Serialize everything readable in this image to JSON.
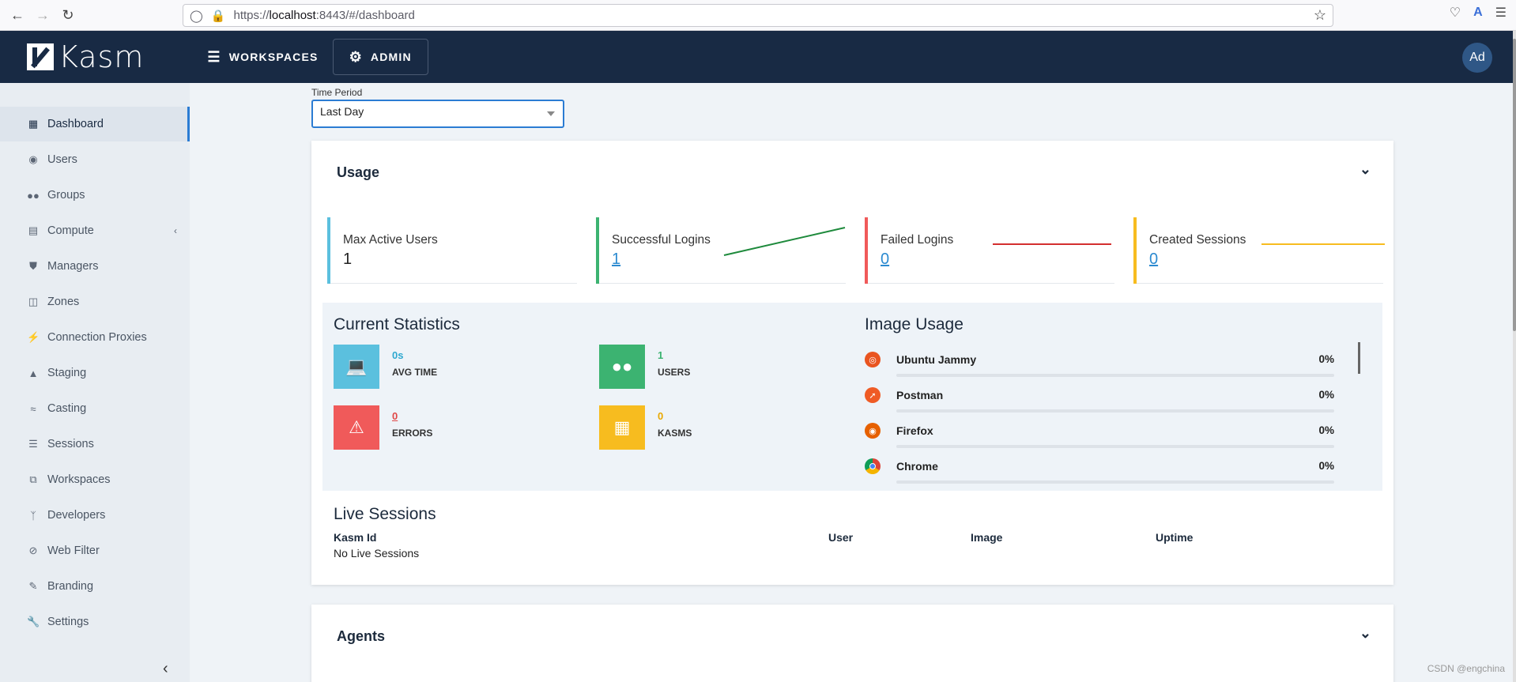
{
  "browser": {
    "url_prefix": "https://",
    "url_host": "localhost",
    "url_rest": ":8443/#/dashboard"
  },
  "app": {
    "logo_text": "Kasm",
    "tabs": [
      {
        "label": "WORKSPACES",
        "icon": "layers-icon"
      },
      {
        "label": "ADMIN",
        "icon": "gear-icon"
      }
    ],
    "avatar": "Ad"
  },
  "sidebar": {
    "items": [
      {
        "label": "Dashboard",
        "icon": "dashboard-icon",
        "active": true
      },
      {
        "label": "Users",
        "icon": "user-circle-icon"
      },
      {
        "label": "Groups",
        "icon": "users-icon"
      },
      {
        "label": "Compute",
        "icon": "server-icon",
        "expandable": true
      },
      {
        "label": "Managers",
        "icon": "shield-icon"
      },
      {
        "label": "Zones",
        "icon": "map-icon"
      },
      {
        "label": "Connection Proxies",
        "icon": "plug-icon"
      },
      {
        "label": "Staging",
        "icon": "flask-icon"
      },
      {
        "label": "Casting",
        "icon": "cast-icon"
      },
      {
        "label": "Sessions",
        "icon": "list-icon"
      },
      {
        "label": "Workspaces",
        "icon": "windows-icon"
      },
      {
        "label": "Developers",
        "icon": "code-branch-icon"
      },
      {
        "label": "Web Filter",
        "icon": "ban-icon"
      },
      {
        "label": "Branding",
        "icon": "brush-icon"
      },
      {
        "label": "Settings",
        "icon": "wrench-icon"
      }
    ]
  },
  "filter": {
    "label": "Time Period",
    "value": "Last Day"
  },
  "usage": {
    "title": "Usage",
    "tiles": [
      {
        "label": "Max Active Users",
        "value": "1",
        "color": "#5bc0de"
      },
      {
        "label": "Successful Logins",
        "value": "1",
        "color": "#3cb371"
      },
      {
        "label": "Failed Logins",
        "value": "0",
        "color": "#f05a5a"
      },
      {
        "label": "Created Sessions",
        "value": "0",
        "color": "#f7bc1f"
      }
    ],
    "current_statistics": {
      "title": "Current Statistics",
      "metrics": [
        {
          "value": "0s",
          "label": "AVG TIME",
          "color": "#5bc0de",
          "icon": "laptop-icon"
        },
        {
          "value": "1",
          "label": "USERS",
          "color": "#3cb371",
          "icon": "users-icon"
        },
        {
          "value": "0",
          "label": "ERRORS",
          "color": "#f05a5a",
          "icon": "warning-icon"
        },
        {
          "value": "0",
          "label": "KASMS",
          "color": "#f7bc1f",
          "icon": "table-icon"
        }
      ]
    },
    "image_usage": {
      "title": "Image Usage",
      "images": [
        {
          "name": "Ubuntu Jammy",
          "percent": "0%",
          "icon": "ubuntu-icon",
          "color": "#e95420"
        },
        {
          "name": "Postman",
          "percent": "0%",
          "icon": "postman-icon",
          "color": "#ef5b25"
        },
        {
          "name": "Firefox",
          "percent": "0%",
          "icon": "firefox-icon",
          "color": "#e66000"
        },
        {
          "name": "Chrome",
          "percent": "0%",
          "icon": "chrome-icon",
          "color": "#4285f4"
        }
      ]
    },
    "live_sessions": {
      "title": "Live Sessions",
      "columns": [
        "Kasm Id",
        "User",
        "Image",
        "Uptime"
      ],
      "empty_text": "No Live Sessions"
    }
  },
  "agents": {
    "title": "Agents"
  },
  "watermark": "CSDN @engchina"
}
